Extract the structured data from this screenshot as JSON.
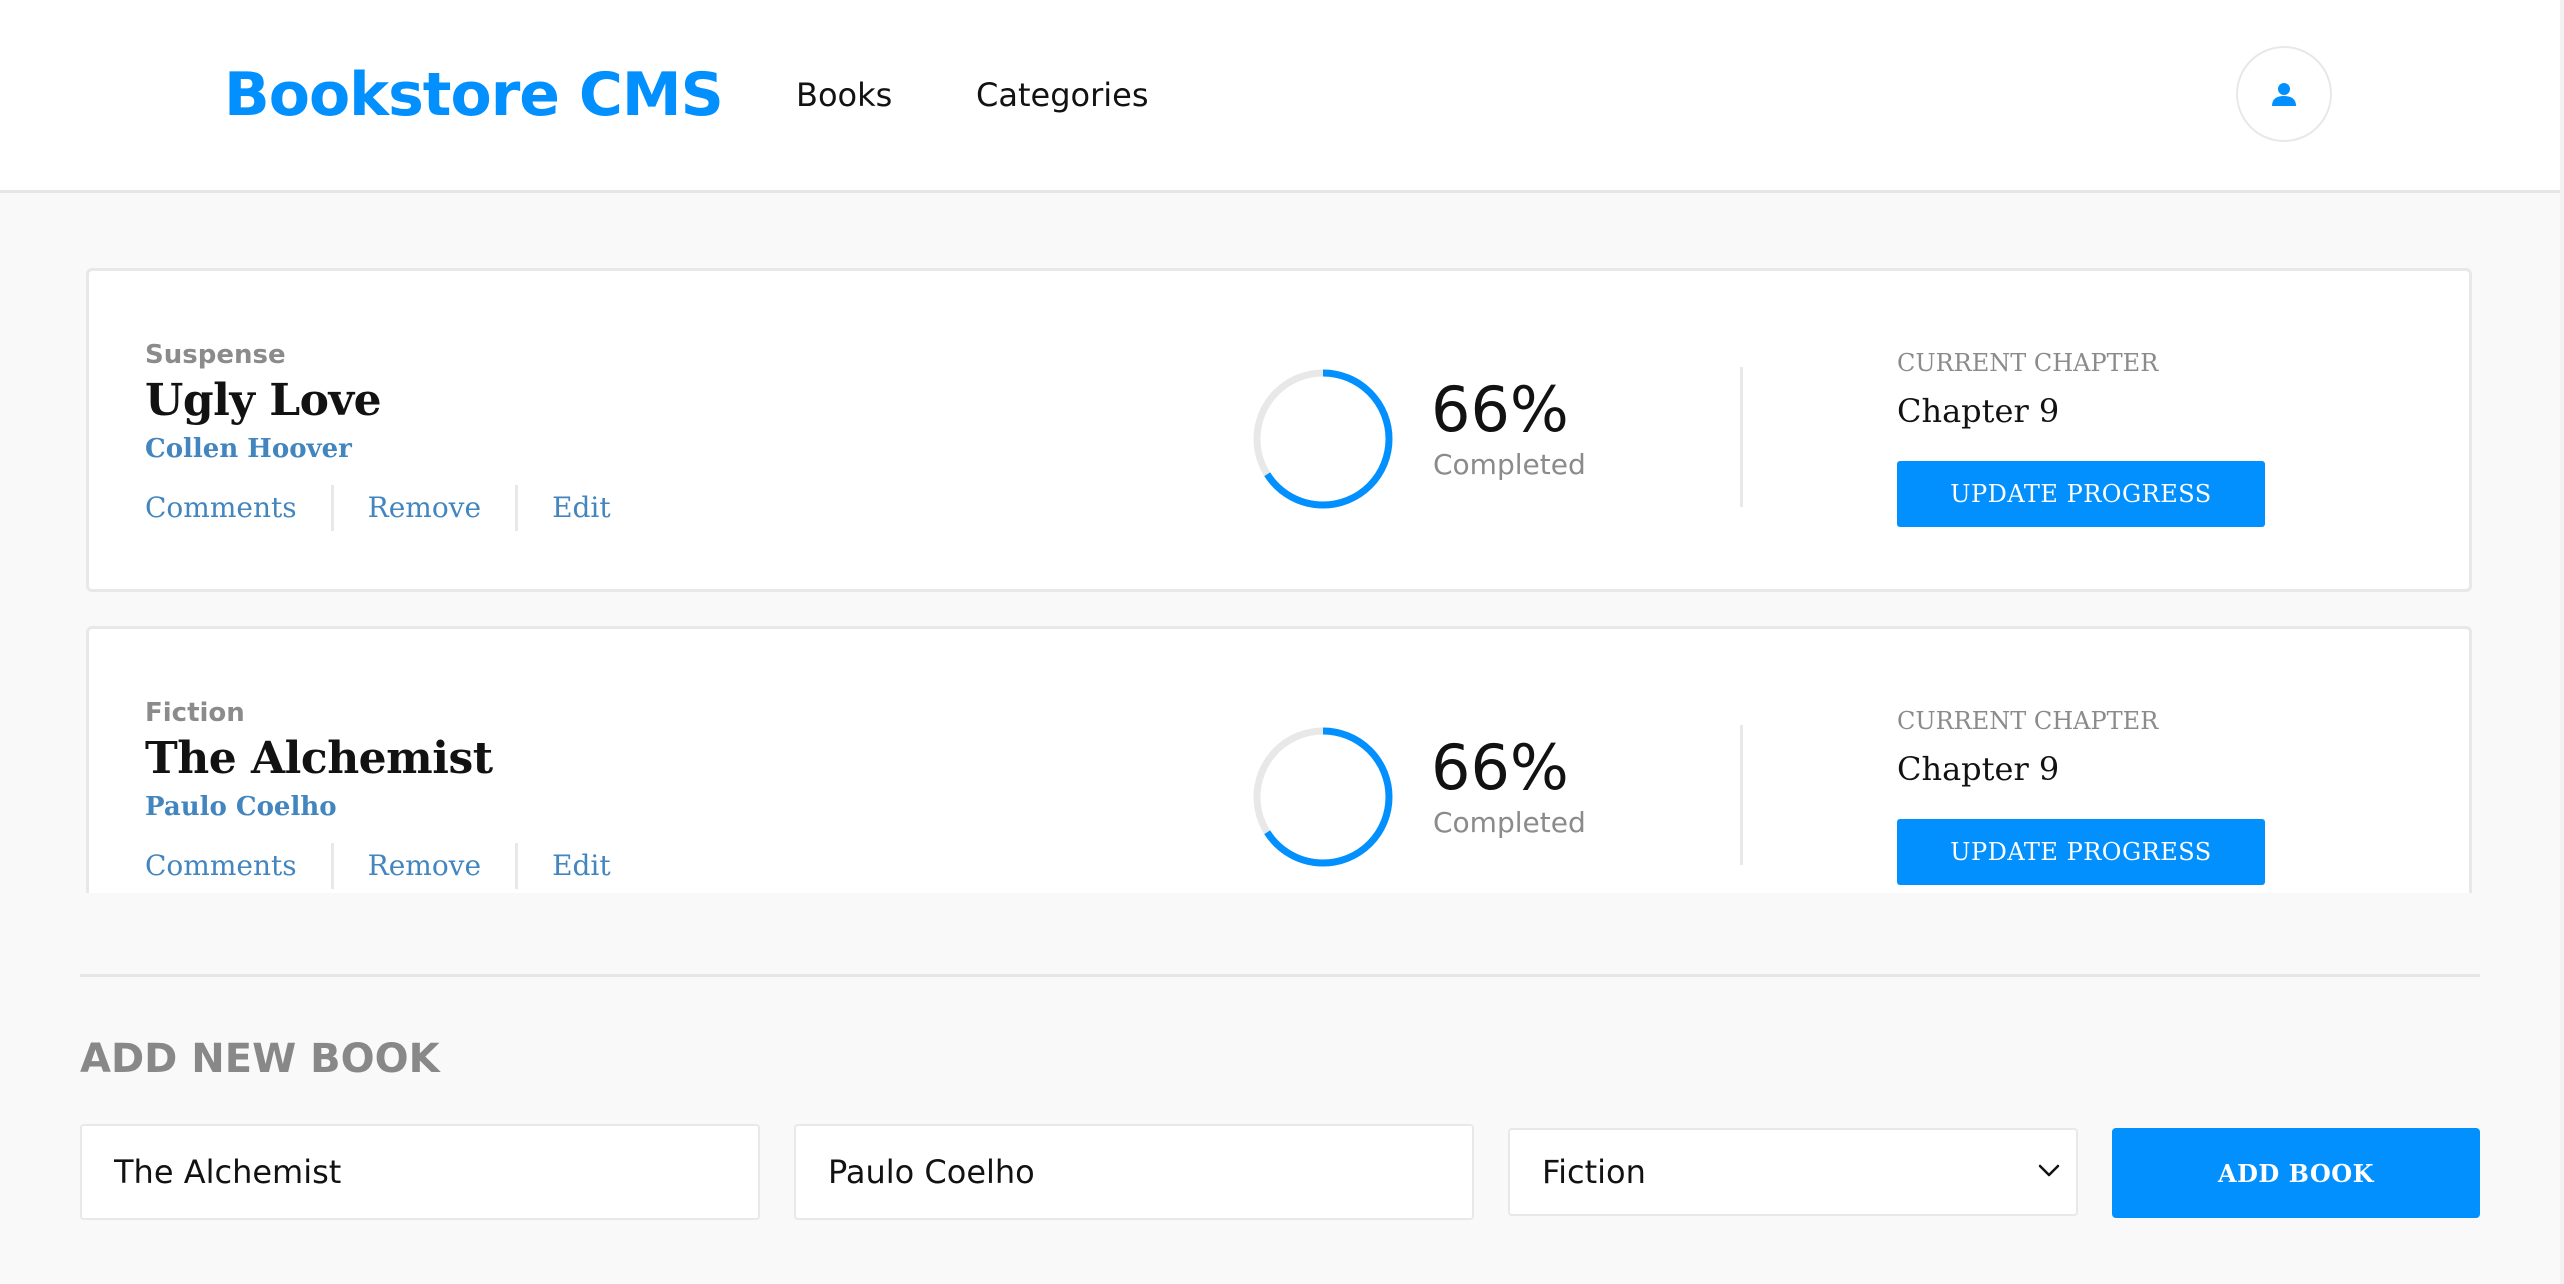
{
  "header": {
    "logo": "Bookstore CMS",
    "nav": [
      {
        "label": "Books"
      },
      {
        "label": "Categories"
      }
    ],
    "user_icon": "user-icon"
  },
  "books": [
    {
      "genre": "Suspense",
      "title": "Ugly Love",
      "author": "Collen Hoover",
      "actions": [
        "Comments",
        "Remove",
        "Edit"
      ],
      "progress": 0.66,
      "percent": "66%",
      "completed_label": "Completed",
      "chapter_label": "CURRENT CHAPTER",
      "chapter": "Chapter 9",
      "update_button": "UPDATE PROGRESS"
    },
    {
      "genre": "Fiction",
      "title": "The Alchemist",
      "author": "Paulo Coelho",
      "actions": [
        "Comments",
        "Remove",
        "Edit"
      ],
      "progress": 0.66,
      "percent": "66%",
      "completed_label": "Completed",
      "chapter_label": "CURRENT CHAPTER",
      "chapter": "Chapter 9",
      "update_button": "UPDATE PROGRESS"
    }
  ],
  "form": {
    "title": "ADD NEW BOOK",
    "title_value": "The Alchemist",
    "author_value": "Paulo Coelho",
    "category_value": "Fiction",
    "submit": "ADD BOOK"
  },
  "colors": {
    "accent": "#0290ff",
    "author_link": "#4386bf",
    "ring_track": "#e8e8e8"
  }
}
